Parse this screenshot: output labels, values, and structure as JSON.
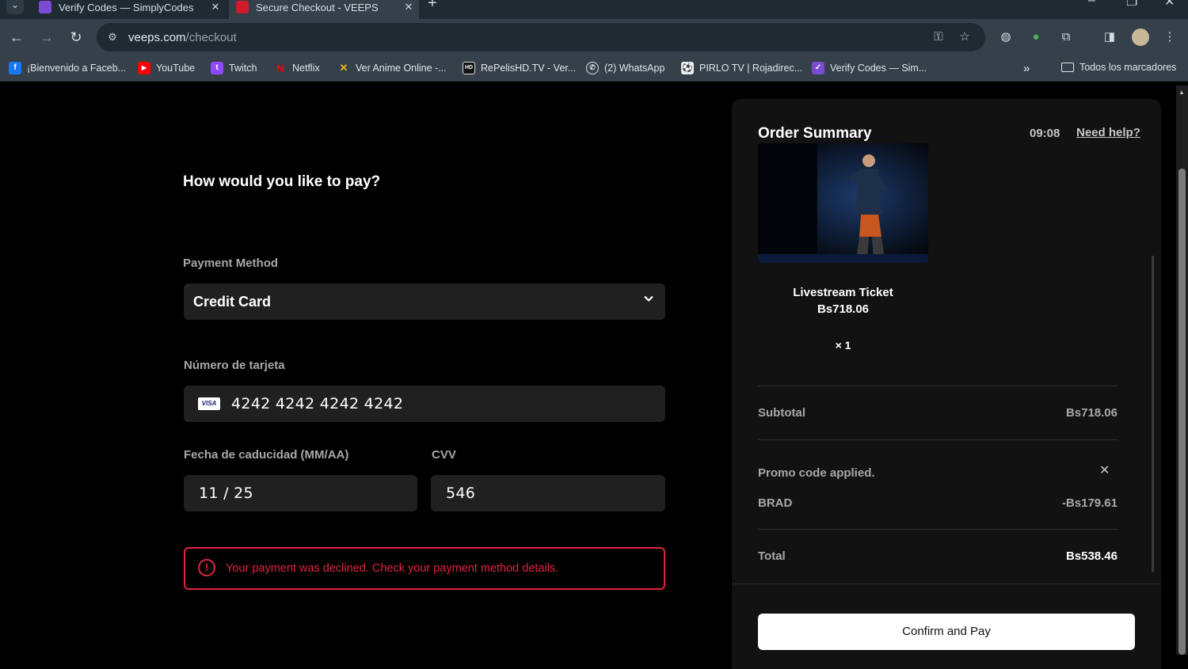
{
  "browser": {
    "tabs": [
      {
        "title": "Verify Codes — SimplyCodes",
        "color": "#7b4bd6"
      },
      {
        "title": "Secure Checkout - VEEPS",
        "color": "#d11a2a"
      }
    ],
    "url_host": "veeps.com",
    "url_path": "/checkout",
    "bookmarks": [
      {
        "label": "¡Bienvenido a Faceb...",
        "icon": "facebook-icon",
        "glyph": "f",
        "color": "#1877f2"
      },
      {
        "label": "YouTube",
        "icon": "youtube-icon",
        "glyph": "▶",
        "color": "#ff0000"
      },
      {
        "label": "Twitch",
        "icon": "twitch-icon",
        "glyph": "t",
        "color": "#9146ff"
      },
      {
        "label": "Netflix",
        "icon": "netflix-icon",
        "glyph": "N",
        "color": "#e50914"
      },
      {
        "label": "Ver Anime Online -...",
        "icon": "anime-icon",
        "glyph": "✕",
        "color": "#e6b422"
      },
      {
        "label": "RePelisHD.TV - Ver...",
        "icon": "hd-icon",
        "glyph": "HD",
        "color": "#111111"
      },
      {
        "label": "(2) WhatsApp",
        "icon": "whatsapp-icon",
        "glyph": "✆",
        "color": "#25d366"
      },
      {
        "label": "PIRLO TV | Rojadirec...",
        "icon": "pirlo-icon",
        "glyph": "⚽",
        "color": "#555555"
      },
      {
        "label": "Verify Codes — Sim...",
        "icon": "simplycodes-icon",
        "glyph": "✓",
        "color": "#7b4bd6"
      }
    ],
    "all_bookmarks": "Todos los marcadores"
  },
  "checkout": {
    "question": "How would you like to pay?",
    "payment_method_label": "Payment Method",
    "payment_method_value": "Credit Card",
    "card_number_label": "Número de tarjeta",
    "card_brand": "VISA",
    "card_number": "4242 4242 4242 4242",
    "expiry_label": "Fecha de caducidad (MM/AA)",
    "expiry_value": "11 / 25",
    "cvv_label": "CVV",
    "cvv_value": "546",
    "error_message": "Your payment was declined. Check your payment method details."
  },
  "summary": {
    "title": "Order Summary",
    "timer": "09:08",
    "help": "Need help?",
    "product_name": "Livestream Ticket",
    "product_price": "Bs718.06",
    "quantity": "× 1",
    "subtotal_label": "Subtotal",
    "subtotal_value": "Bs718.06",
    "promo_label": "Promo code applied.",
    "promo_code": "BRAD",
    "promo_value": "-Bs179.61",
    "total_label": "Total",
    "total_value": "Bs538.46",
    "confirm_label": "Confirm and Pay"
  },
  "colors": {
    "error": "#e2233f",
    "background": "#000000",
    "panel": "#121212",
    "field": "#202020"
  }
}
